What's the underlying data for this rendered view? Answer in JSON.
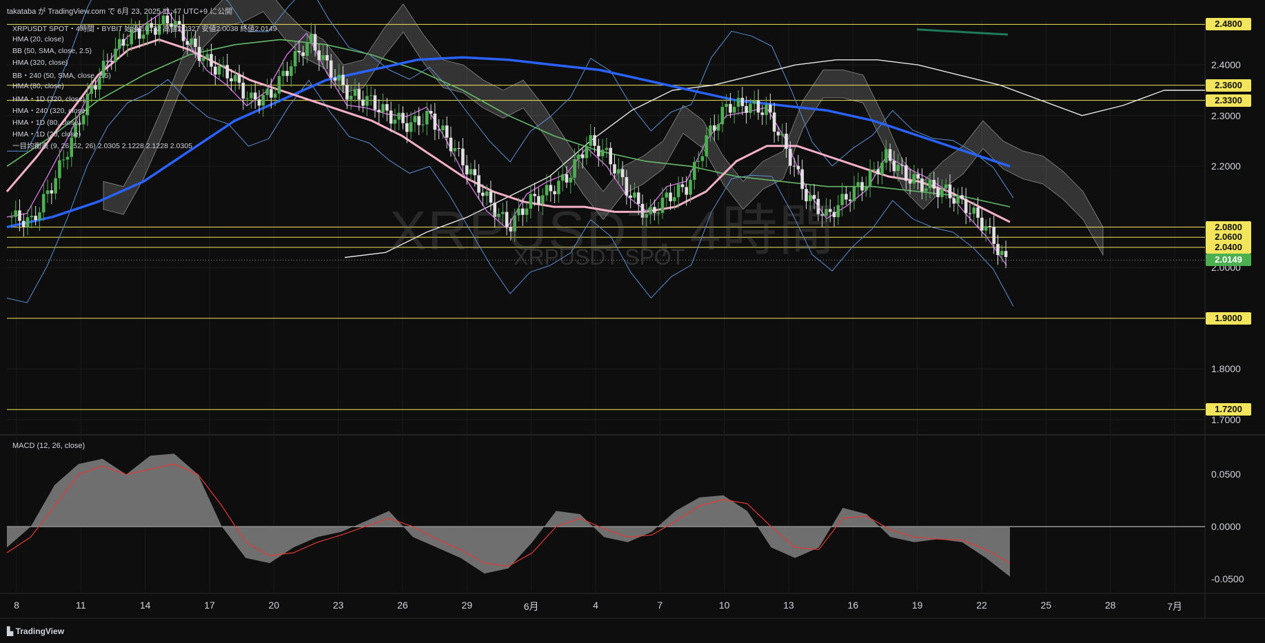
{
  "header": {
    "publish_line": "takataba が TradingView.com で 6月 23, 2025 11:47 UTC+9 に公開"
  },
  "watermark": {
    "main": "XRPUSDT, 4時間",
    "sub": "XRPUSDT SPOT"
  },
  "legend": {
    "symbol_line": "XRPUSDT SPOT・4時間・BYBIT 始値2.0172 高値2.0327 安値2.0038 終値2.0149",
    "indicators": [
      "HMA (20, close)",
      "BB (50, SMA, close, 2.5)",
      "HMA (320, close)",
      "BB・240 (50, SMA, close, 2.5)",
      "HMA (80, close)",
      "HMA・1D (320, close)",
      "HMA・240 (320, close)",
      "HMA・1D (80, close)",
      "HMA・1D (20, close)",
      "一目均衡表 (9, 26, 52, 26)  2.0305  2.1228  2.1228  2.0305"
    ],
    "macd": "MACD (12, 26, close)"
  },
  "footer": {
    "logo_text": "TradingView"
  },
  "colors": {
    "background": "#0e0e0e",
    "grid": "#1c1c1c",
    "up_candle": "#4caf50",
    "down_candle": "#e0e0e0",
    "level_line": "#f2e55c",
    "price_tag": "#f2e55c",
    "last_price": "#4caf50",
    "hma_pink": "#f6b0c8",
    "hma_blue": "#2962ff",
    "hma_green": "#66bb6a",
    "bb_blue": "#5b8fd6",
    "hma_magenta": "#d070e0",
    "macd_hist": "#808080",
    "macd_signal": "#e53935"
  },
  "chart_data": [
    {
      "type": "line",
      "title": "",
      "y_axis": {
        "ticks": [
          "2.4000",
          "2.3000",
          "2.2000",
          "2.0000",
          "1.8000",
          "1.7000"
        ],
        "ylim": [
          1.67,
          2.49
        ]
      },
      "x_axis": {
        "labels": [
          "8",
          "11",
          "14",
          "17",
          "20",
          "23",
          "26",
          "29",
          "6月",
          "4",
          "7",
          "10",
          "13",
          "16",
          "19",
          "22",
          "25",
          "28",
          "7月"
        ]
      },
      "horizontal_levels": [
        {
          "label": "2.4800",
          "value": 2.48
        },
        {
          "label": "2.3600",
          "value": 2.36
        },
        {
          "label": "2.3300",
          "value": 2.33
        },
        {
          "label": "2.0800",
          "value": 2.08
        },
        {
          "label": "2.0600",
          "value": 2.06
        },
        {
          "label": "2.0400",
          "value": 2.04
        },
        {
          "label": "1.9000",
          "value": 1.9
        },
        {
          "label": "1.7200",
          "value": 1.72
        }
      ],
      "last_price": {
        "label": "2.0149",
        "value": 2.0149
      },
      "close_series": [
        2.1,
        2.09,
        2.16,
        2.25,
        2.35,
        2.42,
        2.46,
        2.47,
        2.49,
        2.44,
        2.4,
        2.38,
        2.33,
        2.34,
        2.4,
        2.45,
        2.39,
        2.34,
        2.33,
        2.3,
        2.28,
        2.3,
        2.25,
        2.19,
        2.13,
        2.08,
        2.13,
        2.15,
        2.18,
        2.25,
        2.22,
        2.15,
        2.1,
        2.14,
        2.16,
        2.26,
        2.32,
        2.32,
        2.31,
        2.23,
        2.14,
        2.1,
        2.14,
        2.17,
        2.22,
        2.18,
        2.16,
        2.15,
        2.12,
        2.08,
        2.01
      ],
      "series": [
        {
          "name": "HMA (20, close)",
          "values": [
            2.15,
            2.22,
            2.3,
            2.38,
            2.43,
            2.45,
            2.43,
            2.4,
            2.37,
            2.35,
            2.33,
            2.31,
            2.29,
            2.26,
            2.22,
            2.18,
            2.15,
            2.13,
            2.12,
            2.12,
            2.11,
            2.11,
            2.12,
            2.15,
            2.21,
            2.24,
            2.24,
            2.22,
            2.2,
            2.18,
            2.17,
            2.15,
            2.12,
            2.09
          ]
        },
        {
          "name": "HMA (320, close)",
          "values": [
            2.08,
            2.1,
            2.13,
            2.17,
            2.23,
            2.29,
            2.33,
            2.37,
            2.39,
            2.41,
            2.415,
            2.41,
            2.4,
            2.39,
            2.37,
            2.35,
            2.33,
            2.32,
            2.31,
            2.29,
            2.26,
            2.23,
            2.2
          ]
        },
        {
          "name": "HMA (80, close)",
          "values": [
            2.2,
            2.26,
            2.33,
            2.38,
            2.42,
            2.44,
            2.45,
            2.44,
            2.42,
            2.39,
            2.35,
            2.3,
            2.26,
            2.23,
            2.21,
            2.2,
            2.18,
            2.17,
            2.16,
            2.16,
            2.15,
            2.14,
            2.12
          ]
        }
      ]
    },
    {
      "type": "area",
      "title": "",
      "y_axis": {
        "ticks": [
          "0.0500",
          "0.0000",
          "-0.0500"
        ],
        "ylim": [
          -0.062,
          0.082
        ]
      },
      "series": [
        {
          "name": "",
          "values": [
            -0.02,
            0.0,
            0.04,
            0.06,
            0.065,
            0.05,
            0.068,
            0.07,
            0.05,
            0.0,
            -0.03,
            -0.035,
            -0.02,
            -0.01,
            -0.005,
            0.005,
            0.015,
            -0.01,
            -0.02,
            -0.03,
            -0.045,
            -0.04,
            -0.015,
            0.015,
            0.012,
            -0.01,
            -0.015,
            -0.005,
            0.015,
            0.028,
            0.03,
            0.015,
            -0.02,
            -0.03,
            -0.02,
            0.018,
            0.012,
            -0.01,
            -0.015,
            -0.012,
            -0.015,
            -0.03,
            -0.048
          ]
        },
        {
          "name": "",
          "values": [
            -0.025,
            -0.01,
            0.02,
            0.05,
            0.058,
            0.05,
            0.055,
            0.06,
            0.05,
            0.02,
            -0.015,
            -0.028,
            -0.025,
            -0.015,
            -0.008,
            0.0,
            0.008,
            0.0,
            -0.012,
            -0.022,
            -0.035,
            -0.038,
            -0.025,
            0.0,
            0.008,
            -0.002,
            -0.01,
            -0.008,
            0.005,
            0.02,
            0.026,
            0.022,
            0.0,
            -0.02,
            -0.022,
            0.008,
            0.01,
            -0.003,
            -0.01,
            -0.012,
            -0.013,
            -0.022,
            -0.035
          ]
        }
      ]
    }
  ]
}
